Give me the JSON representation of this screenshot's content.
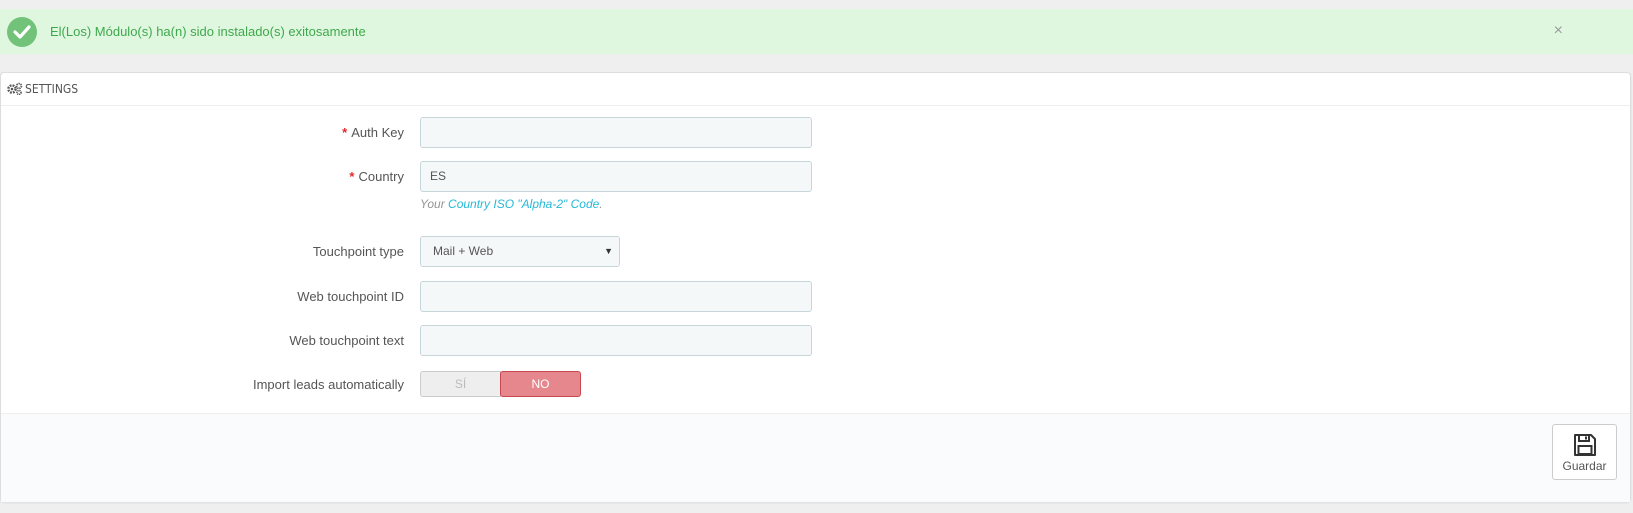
{
  "alert": {
    "message": "El(Los) Módulo(s) ha(n) sido instalado(s) exitosamente",
    "close_glyph": "×",
    "icon": "check-circle-icon",
    "color": "#72c279"
  },
  "panel": {
    "icon": "gears-icon",
    "title": "SETTINGS"
  },
  "form": {
    "required_marker": "*",
    "auth_key": {
      "label": "Auth Key",
      "value": "",
      "required": true
    },
    "country": {
      "label": "Country",
      "value": "ES",
      "required": true,
      "help_prefix": "Your ",
      "help_link": "Country ISO \"Alpha-2\" Code",
      "help_suffix": "."
    },
    "touchpoint_type": {
      "label": "Touchpoint type",
      "selected": "Mail + Web"
    },
    "web_touchpoint_id": {
      "label": "Web touchpoint ID",
      "value": ""
    },
    "web_touchpoint_text": {
      "label": "Web touchpoint text",
      "value": ""
    },
    "import_leads": {
      "label": "Import leads automatically",
      "yes_label": "SÍ",
      "no_label": "NO",
      "selected": "NO",
      "no_color": "#e6878d"
    }
  },
  "footer": {
    "save_label": "Guardar",
    "save_icon": "floppy-disk-icon"
  }
}
